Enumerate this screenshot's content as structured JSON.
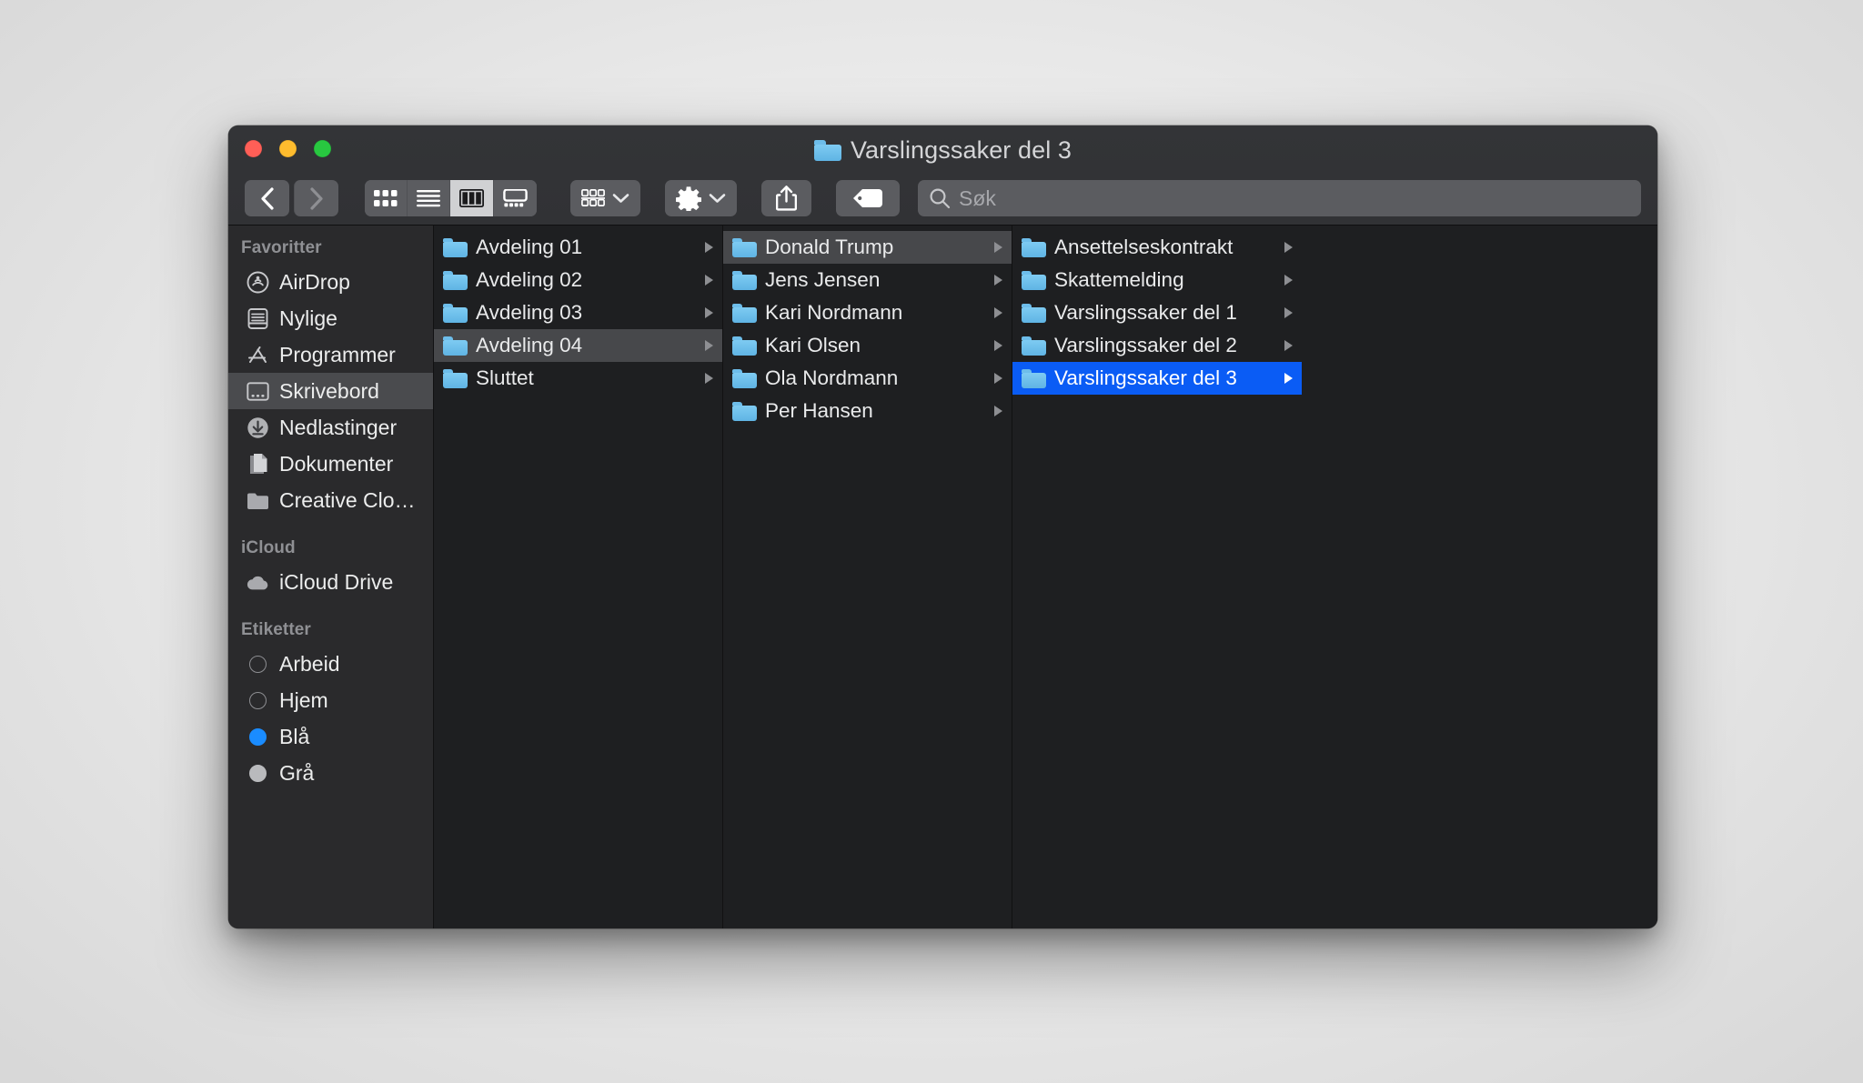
{
  "window": {
    "title": "Varslingssaker del 3",
    "title_icon": "folder-icon",
    "traffic_lights": {
      "close_label": "close",
      "minimize_label": "minimize",
      "maximize_label": "maximize",
      "close_color": "#ff5f57",
      "minimize_color": "#febc2e",
      "maximize_color": "#28c840"
    }
  },
  "toolbar": {
    "back_label": "back-icon",
    "forward_label": "forward-icon",
    "view_icon_label": "icon-view-icon",
    "view_list_label": "list-view-icon",
    "view_column_label": "column-view-icon",
    "view_gallery_label": "gallery-view-icon",
    "group_label": "group-by-icon",
    "group_chevron": "chevron-down-icon",
    "action_label": "gear-icon",
    "action_chevron": "chevron-down-icon",
    "share_label": "share-icon",
    "tag_label": "tag-icon",
    "active_view": "column",
    "search": {
      "icon": "search-icon",
      "placeholder": "Søk",
      "value": ""
    }
  },
  "sidebar": {
    "sections": [
      {
        "header": "Favoritter",
        "items": [
          {
            "label": "AirDrop",
            "icon": "airdrop-icon",
            "selected": false
          },
          {
            "label": "Nylige",
            "icon": "recents-icon",
            "selected": false
          },
          {
            "label": "Programmer",
            "icon": "applications-icon",
            "selected": false
          },
          {
            "label": "Skrivebord",
            "icon": "desktop-icon",
            "selected": true
          },
          {
            "label": "Nedlastinger",
            "icon": "downloads-icon",
            "selected": false
          },
          {
            "label": "Dokumenter",
            "icon": "documents-icon",
            "selected": false
          },
          {
            "label": "Creative Clo…",
            "icon": "folder-icon",
            "selected": false
          }
        ]
      },
      {
        "header": "iCloud",
        "items": [
          {
            "label": "iCloud Drive",
            "icon": "cloud-icon",
            "selected": false
          }
        ]
      },
      {
        "header": "Etiketter",
        "items": [
          {
            "label": "Arbeid",
            "icon": "tag-dot-hollow",
            "selected": false
          },
          {
            "label": "Hjem",
            "icon": "tag-dot-hollow",
            "selected": false
          },
          {
            "label": "Blå",
            "icon": "tag-dot-blue",
            "selected": false,
            "color": "#1a8cff"
          },
          {
            "label": "Grå",
            "icon": "tag-dot-gray",
            "selected": false,
            "color": "#b9babd"
          }
        ]
      }
    ]
  },
  "columns": [
    {
      "name": "column-1",
      "rows": [
        {
          "label": "Avdeling 01",
          "icon": "folder-icon",
          "state": "none",
          "has_chevron": true
        },
        {
          "label": "Avdeling 02",
          "icon": "folder-icon",
          "state": "none",
          "has_chevron": true
        },
        {
          "label": "Avdeling 03",
          "icon": "folder-icon",
          "state": "none",
          "has_chevron": true
        },
        {
          "label": "Avdeling 04",
          "icon": "folder-icon",
          "state": "highlight",
          "has_chevron": true
        },
        {
          "label": "Sluttet",
          "icon": "folder-icon",
          "state": "none",
          "has_chevron": true
        }
      ]
    },
    {
      "name": "column-2",
      "rows": [
        {
          "label": "Donald Trump",
          "icon": "folder-icon",
          "state": "highlight",
          "has_chevron": true
        },
        {
          "label": "Jens Jensen",
          "icon": "folder-icon",
          "state": "none",
          "has_chevron": true
        },
        {
          "label": "Kari Nordmann",
          "icon": "folder-icon",
          "state": "none",
          "has_chevron": true
        },
        {
          "label": "Kari Olsen",
          "icon": "folder-icon",
          "state": "none",
          "has_chevron": true
        },
        {
          "label": "Ola Nordmann",
          "icon": "folder-icon",
          "state": "none",
          "has_chevron": true
        },
        {
          "label": "Per Hansen",
          "icon": "folder-icon",
          "state": "none",
          "has_chevron": true
        }
      ]
    },
    {
      "name": "column-3",
      "rows": [
        {
          "label": "Ansettelseskontrakt",
          "icon": "folder-icon",
          "state": "none",
          "has_chevron": true
        },
        {
          "label": "Skattemelding",
          "icon": "folder-icon",
          "state": "none",
          "has_chevron": true
        },
        {
          "label": "Varslingssaker del 1",
          "icon": "folder-icon",
          "state": "none",
          "has_chevron": true
        },
        {
          "label": "Varslingssaker del 2",
          "icon": "folder-icon",
          "state": "none",
          "has_chevron": true
        },
        {
          "label": "Varslingssaker del 3",
          "icon": "folder-icon",
          "state": "selected",
          "has_chevron": true
        }
      ]
    }
  ],
  "colors": {
    "selection_blue": "#0a5cf5",
    "highlight_gray": "#47484b",
    "window_bg": "#1e1f21",
    "sidebar_bg": "#2a2a2c",
    "titlebar_bg": "#323336",
    "folder_blue": "#6dc0ee"
  }
}
